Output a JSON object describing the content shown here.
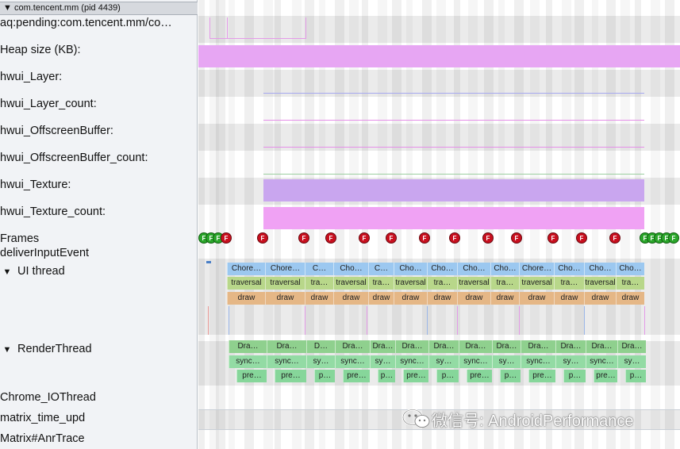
{
  "process_header": {
    "toggle": "▼",
    "title": "com.tencent.mm (pid 4439)"
  },
  "tracks": [
    {
      "label": "aq:pending:com.tencent.mm/co…"
    },
    {
      "label": "Heap size (KB):"
    },
    {
      "label": "hwui_Layer:"
    },
    {
      "label": "hwui_Layer_count:"
    },
    {
      "label": "hwui_OffscreenBuffer:"
    },
    {
      "label": "hwui_OffscreenBuffer_count:"
    },
    {
      "label": "hwui_Texture:"
    },
    {
      "label": "hwui_Texture_count:"
    },
    {
      "label": "Frames"
    },
    {
      "label": "deliverInputEvent"
    },
    {
      "label": "UI thread",
      "toggle": "▼"
    },
    {
      "label": "RenderThread",
      "toggle": "▼"
    },
    {
      "label": "Chrome_IOThread"
    },
    {
      "label": "matrix_time_upd"
    },
    {
      "label": "Matrix#AnrTrace"
    }
  ],
  "frame_markers": {
    "glyph": "F",
    "colors": {
      "red": "#c80f1e",
      "green": "#2aa52a"
    },
    "left_green_count": 3,
    "red_count": 14,
    "right_green_count": 5
  },
  "ui_thread": {
    "choreographer": [
      "Chore…",
      "Chore…",
      "C…",
      "Cho…",
      "C…",
      "Cho…",
      "Cho…",
      "Cho…",
      "Cho…",
      "Chore…",
      "Cho…",
      "Cho…",
      "Cho…"
    ],
    "traversal": [
      "traversal",
      "traversal",
      "tra…",
      "traversal",
      "tra…",
      "traversal",
      "tra…",
      "traversal",
      "tra…",
      "traversal",
      "tra…",
      "traversal",
      "tra…"
    ],
    "draw": [
      "draw",
      "draw",
      "draw",
      "draw",
      "draw",
      "draw",
      "draw",
      "draw",
      "draw",
      "draw",
      "draw",
      "draw",
      "draw"
    ]
  },
  "render_thread": {
    "drawframe": [
      "Dra…",
      "Dra…",
      "D…",
      "Dra…",
      "Dra…",
      "Dra…",
      "Dra…",
      "Dra…",
      "Dra…",
      "Dra…",
      "Dra…",
      "Dra…",
      "Dra…"
    ],
    "sync": [
      "sync…",
      "sync…",
      "sy…",
      "sync…",
      "sy…",
      "sync…",
      "sy…",
      "sync…",
      "sy…",
      "sync…",
      "sy…",
      "sync…",
      "sy…"
    ],
    "prepare": [
      "pre…",
      "pre…",
      "p…",
      "pre…",
      "p…",
      "pre…",
      "p…",
      "pre…",
      "p…",
      "pre…",
      "p…",
      "pre…",
      "p…"
    ]
  },
  "colors": {
    "heap": "#e7a6f3",
    "texture": "#c9a6ef",
    "texture_count": "#f0a2f4",
    "choreographer": "#9cc8f0",
    "traversal": "#b8d78a",
    "draw": "#e5b786",
    "render": "#8fd08e"
  },
  "watermark": {
    "icon": "wechat-icon",
    "text": "微信号: AndroidPerformance"
  }
}
